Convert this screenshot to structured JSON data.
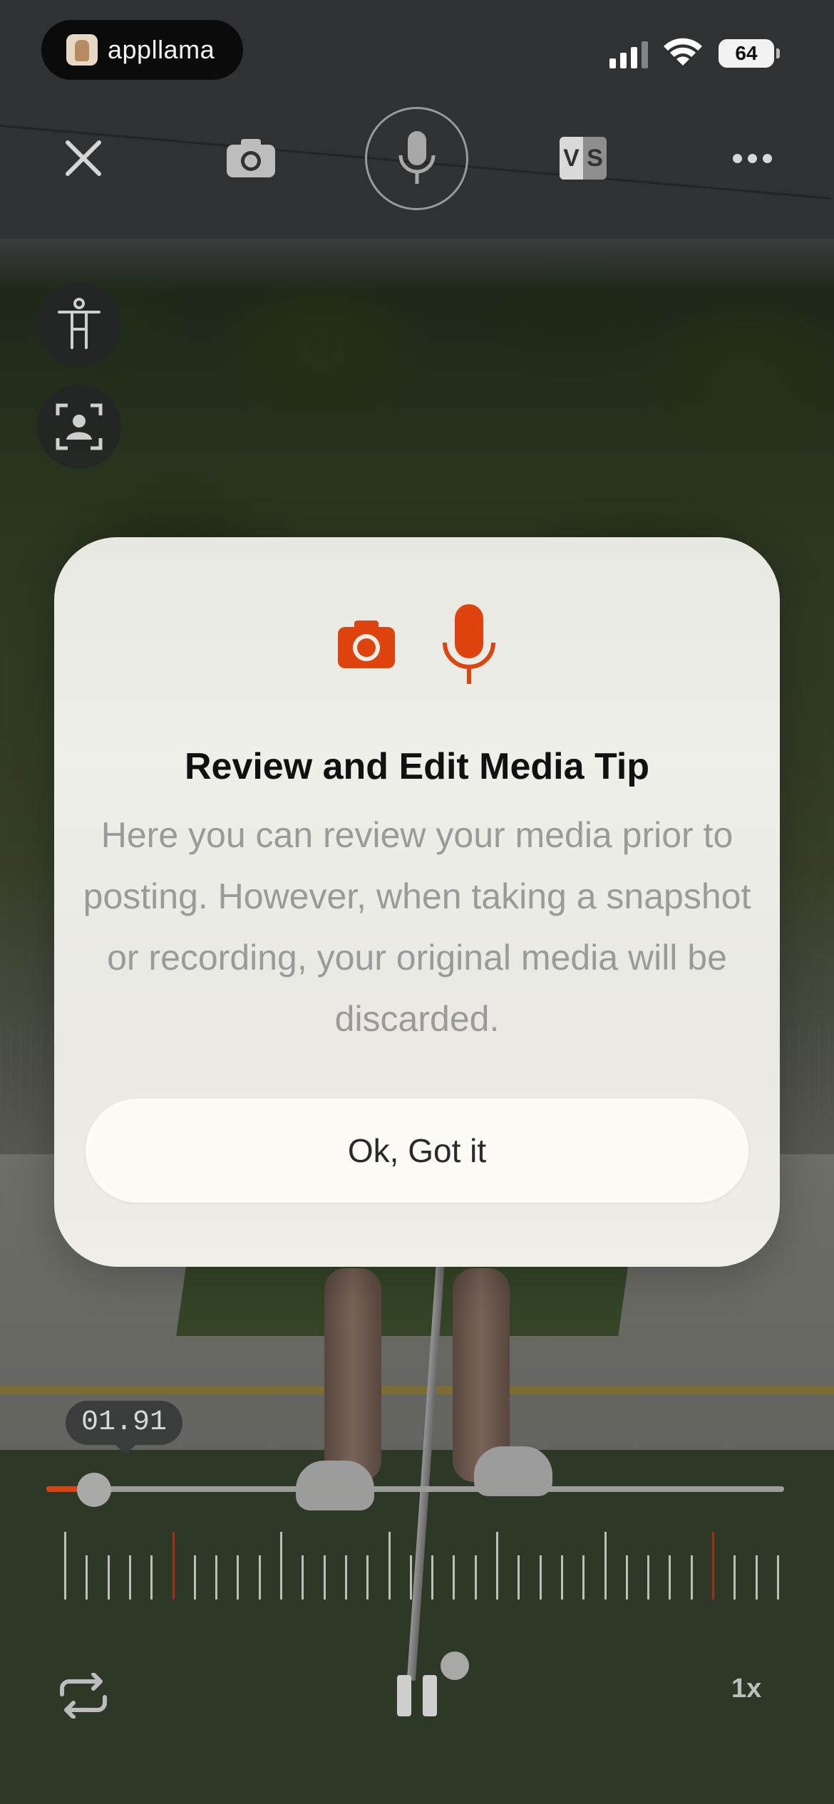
{
  "status_bar": {
    "app_name": "appllama",
    "battery": "64",
    "icons": [
      "llama-logo-icon",
      "cellular-signal-icon",
      "wifi-icon",
      "battery-icon"
    ]
  },
  "toolbar": {
    "icons": [
      "close-icon",
      "camera-icon",
      "microphone-icon",
      "versus-compare-icon",
      "more-options-icon"
    ],
    "vs_left": "V",
    "vs_right": "S"
  },
  "side_tools": {
    "icons": [
      "body-pose-icon",
      "face-frame-icon"
    ]
  },
  "dialog": {
    "title": "Review and Edit Media Tip",
    "body": "Here you can review your media prior to posting. However, when taking a snapshot or recording, your original media will be discarded.",
    "button_label": "Ok, Got it",
    "icons": [
      "camera-icon",
      "microphone-icon"
    ],
    "accent_color": "#E0440E"
  },
  "playback": {
    "timestamp": "01.91",
    "progress_fraction": 0.065,
    "speed": "1x",
    "icons": [
      "repeat-icon",
      "pause-icon"
    ],
    "progress_color": "#D84315"
  }
}
